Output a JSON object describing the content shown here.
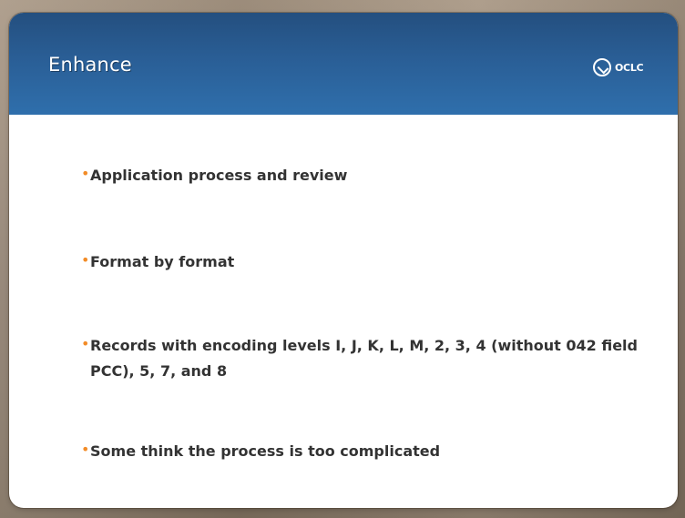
{
  "slide": {
    "title": "Enhance",
    "logo_text": "OCLC",
    "bullets": [
      "Application process and review",
      "Format by format",
      "Records with encoding levels I, J, K, L, M, 2, 3, 4 (without 042 field PCC), 5, 7, and 8",
      "Some think the process is too complicated"
    ]
  },
  "colors": {
    "header_top": "#244f7f",
    "header_bottom": "#2f6fac",
    "bullet": "#f28c28",
    "text": "#333333",
    "background": "#9a8b7b"
  }
}
